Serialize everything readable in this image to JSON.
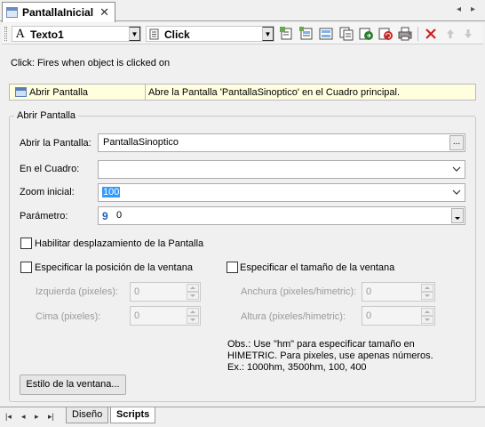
{
  "window": {
    "tab_title": "PantallaInicial",
    "close_glyph": "✕",
    "nav_left": "◂",
    "nav_right": "▸"
  },
  "toolbar": {
    "object_combo": {
      "icon": "A",
      "value": "Texto1"
    },
    "event_combo": {
      "value": "Click"
    },
    "buttons": [
      "add-action-icon",
      "insert-action-icon",
      "edit-action-icon",
      "copy-action-icon",
      "export-action-icon",
      "refresh-action-icon",
      "print-action-icon",
      "delete-icon",
      "move-up-icon",
      "move-down-icon"
    ]
  },
  "hint": "Click: Fires when object is clicked on",
  "action": {
    "name": "Abrir Pantalla",
    "description": "Abre la Pantalla 'PantallaSinoptico' en el Cuadro principal."
  },
  "group": {
    "title": "Abrir Pantalla",
    "fields": {
      "screen_label": "Abrir la Pantalla:",
      "screen_value": "PantallaSinoptico",
      "browse_label": "...",
      "frame_label": "En el Cuadro:",
      "frame_value": "",
      "zoom_label": "Zoom inicial:",
      "zoom_value": "100",
      "param_label": "Parámetro:",
      "param_icon": "9",
      "param_value": "0"
    },
    "checkboxes": {
      "scroll": "Habilitar desplazamiento de la Pantalla",
      "position": "Especificar la posición de la ventana",
      "size": "Especificar el tamaño de la ventana"
    },
    "position": {
      "left_label": "Izquierda (pixeles):",
      "left_value": "0",
      "top_label": "Cima (pixeles):",
      "top_value": "0"
    },
    "size": {
      "width_label": "Anchura (pixeles/himetric):",
      "width_value": "0",
      "height_label": "Altura (pixeles/himetric):",
      "height_value": "0"
    },
    "obs": [
      "Obs.: Use \"hm\" para especificar tamaño en",
      "HIMETRIC. Para pixeles, use apenas números.",
      "Ex.: 1000hm, 3500hm, 100, 400"
    ],
    "window_style_button": "Estilo de la ventana..."
  },
  "bottom_tabs": [
    "Diseño",
    "Scripts"
  ],
  "colors": {
    "selection": "#3399ff",
    "action_row_bg": "#ffffe0",
    "param_icon": "#1f5fbf",
    "delete": "#cc2222"
  }
}
